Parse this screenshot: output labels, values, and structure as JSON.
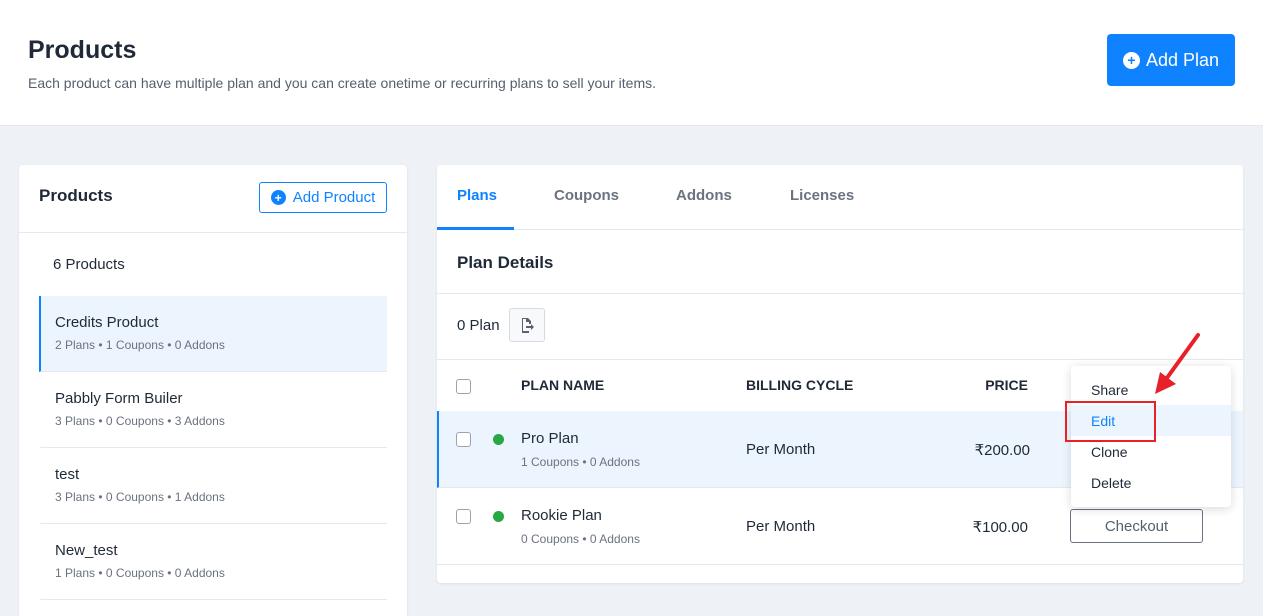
{
  "header": {
    "title": "Products",
    "subtitle": "Each product can have multiple plan and you can create onetime or recurring plans to sell your items.",
    "add_plan_label": "Add Plan"
  },
  "products_panel": {
    "title": "Products",
    "add_product_label": "Add Product",
    "count_label": "6 Products",
    "items": [
      {
        "name": "Credits Product",
        "meta": "2 Plans • 1 Coupons • 0 Addons",
        "active": true
      },
      {
        "name": "Pabbly Form Builer",
        "meta": "3 Plans • 0 Coupons • 3 Addons"
      },
      {
        "name": "test",
        "meta": "3 Plans • 0 Coupons • 1 Addons"
      },
      {
        "name": "New_test",
        "meta": "1 Plans • 0 Coupons • 0 Addons"
      }
    ]
  },
  "plans_panel": {
    "tabs": [
      "Plans",
      "Coupons",
      "Addons",
      "Licenses"
    ],
    "active_tab": "Plans",
    "section_title": "Plan Details",
    "plan_count": "0 Plan",
    "columns": {
      "name": "PLAN NAME",
      "cycle": "BILLING CYCLE",
      "price": "PRICE"
    },
    "rows": [
      {
        "name": "Pro Plan",
        "meta": "1 Coupons • 0 Addons",
        "cycle": "Per Month",
        "price": "₹200.00"
      },
      {
        "name": "Rookie Plan",
        "meta": "0 Coupons • 0 Addons",
        "cycle": "Per Month",
        "price": "₹100.00",
        "action": "Checkout"
      }
    ]
  },
  "dropdown": {
    "items": [
      "Share",
      "Edit",
      "Clone",
      "Delete"
    ],
    "highlighted": "Edit"
  },
  "colors": {
    "primary": "#0f83ff",
    "active_bg": "#ecf5fe",
    "status_green": "#28a745",
    "annotation_red": "#e8202a"
  },
  "icons": {
    "add": "plus-circle-icon",
    "export": "file-export-icon",
    "status": "status-dot-icon",
    "annotation": "arrow-annotation-icon"
  }
}
